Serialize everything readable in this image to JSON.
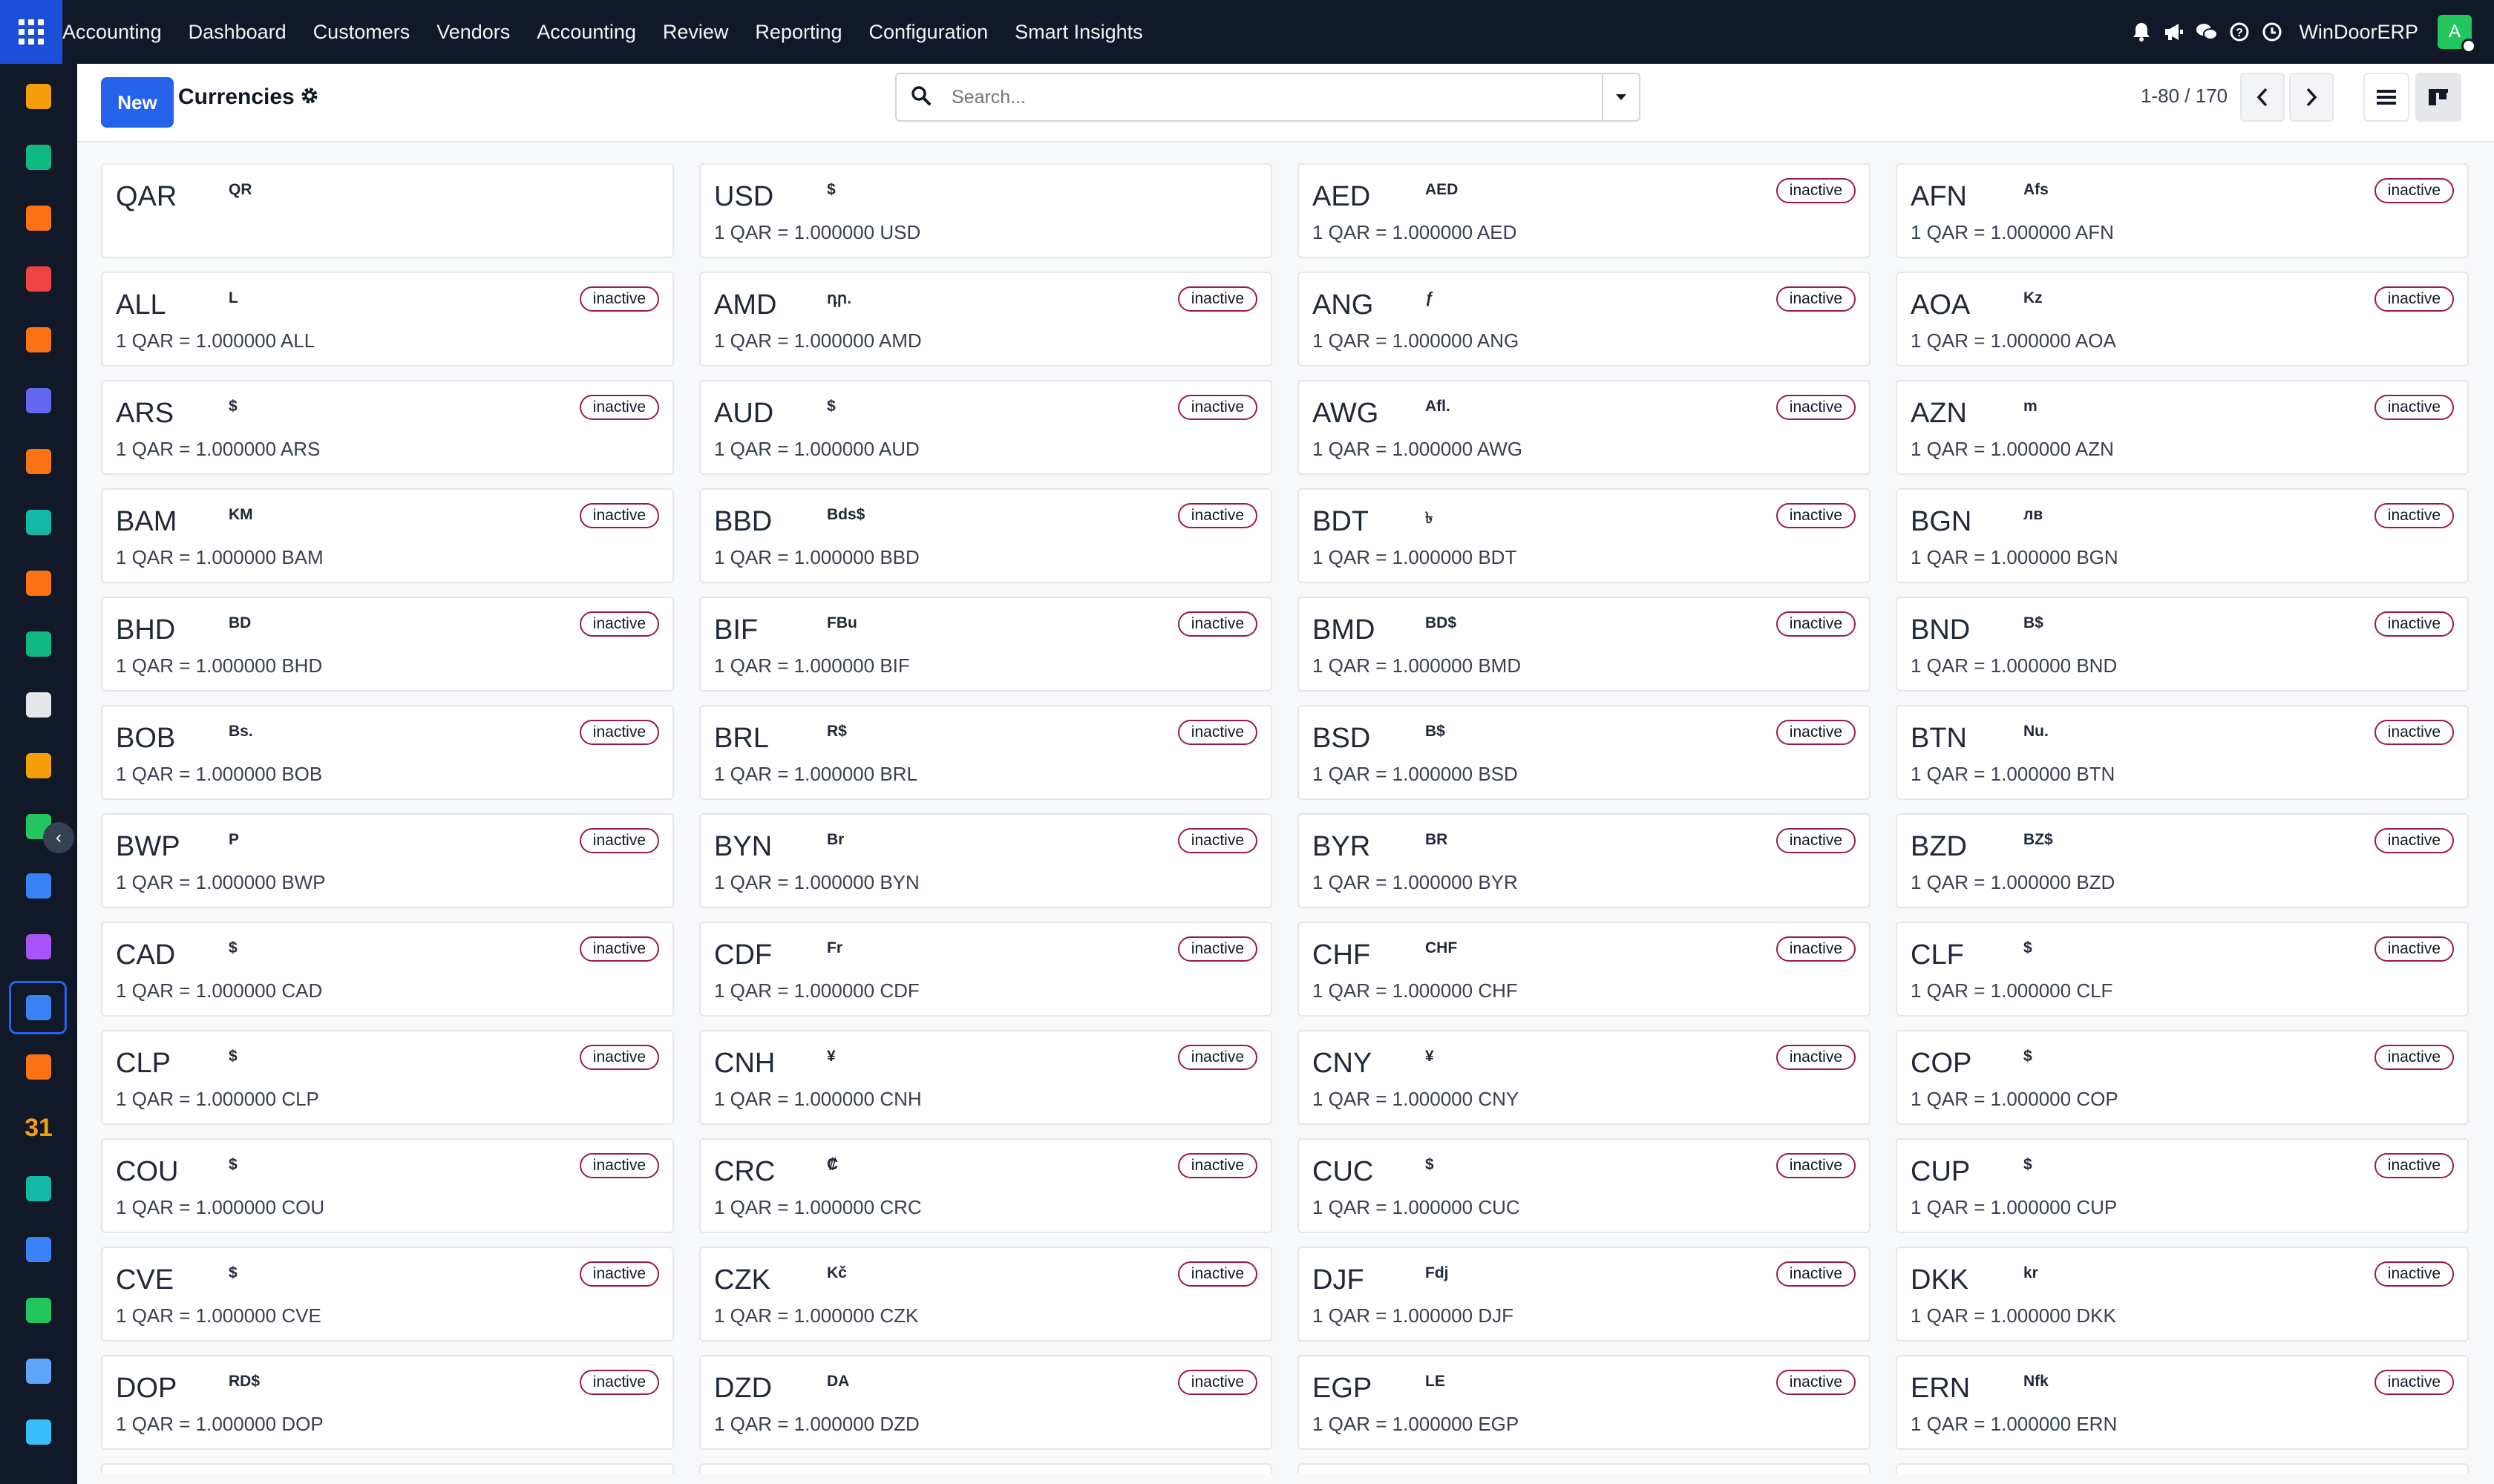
{
  "navbar": {
    "brand": "Accounting",
    "menu": [
      "Dashboard",
      "Customers",
      "Vendors",
      "Accounting",
      "Review",
      "Reporting",
      "Configuration",
      "Smart Insights"
    ],
    "company": "WinDoorERP",
    "avatar_letter": "A",
    "icons": [
      "bell-icon",
      "megaphone-icon",
      "chat-icon",
      "help-icon",
      "clock-icon"
    ]
  },
  "rail": {
    "apps": [
      {
        "name": "dashboard-app",
        "color": "#f59e0b"
      },
      {
        "name": "contacts-app",
        "color": "#10b981"
      },
      {
        "name": "reporting-app",
        "color": "#f97316"
      },
      {
        "name": "pie-app",
        "color": "#ef4444"
      },
      {
        "name": "discuss-app",
        "color": "#f97316"
      },
      {
        "name": "mail-app",
        "color": "#6366f1"
      },
      {
        "name": "livechat-app",
        "color": "#f97316"
      },
      {
        "name": "field-app",
        "color": "#14b8a6"
      },
      {
        "name": "sales-app",
        "color": "#f97316"
      },
      {
        "name": "employees-app",
        "color": "#10b981"
      },
      {
        "name": "inventory-app",
        "color": "#e5e7eb"
      },
      {
        "name": "studio-app",
        "color": "#f59e0b"
      },
      {
        "name": "project-app",
        "color": "#22c55e"
      },
      {
        "name": "knowledge-app",
        "color": "#3b82f6"
      },
      {
        "name": "package-app",
        "color": "#a855f7"
      },
      {
        "name": "accounting-app",
        "color": "#3b82f6"
      },
      {
        "name": "team-app",
        "color": "#f97316"
      },
      {
        "name": "calendar-app",
        "color": "#f59e0b"
      },
      {
        "name": "sign-app",
        "color": "#14b8a6"
      },
      {
        "name": "website-app",
        "color": "#3b82f6"
      },
      {
        "name": "whatsapp-app",
        "color": "#22c55e"
      },
      {
        "name": "timer-app",
        "color": "#60a5fa"
      },
      {
        "name": "odoo-app",
        "color": "#38bdf8"
      }
    ],
    "calendar_label": "31"
  },
  "control": {
    "new_label": "New",
    "title": "Currencies",
    "search_placeholder": "Search...",
    "pager": "1-80 / 170"
  },
  "cards": [
    {
      "code": "QAR",
      "symbol": "QR",
      "badge": "",
      "rate": ""
    },
    {
      "code": "USD",
      "symbol": "$",
      "badge": "",
      "rate": "1 QAR = 1.000000 USD"
    },
    {
      "code": "AED",
      "symbol": "AED",
      "badge": "inactive",
      "rate": "1 QAR = 1.000000 AED"
    },
    {
      "code": "AFN",
      "symbol": "Afs",
      "badge": "inactive",
      "rate": "1 QAR = 1.000000 AFN"
    },
    {
      "code": "ALL",
      "symbol": "L",
      "badge": "inactive",
      "rate": "1 QAR = 1.000000 ALL"
    },
    {
      "code": "AMD",
      "symbol": "դր.",
      "badge": "inactive",
      "rate": "1 QAR = 1.000000 AMD"
    },
    {
      "code": "ANG",
      "symbol": "ƒ",
      "badge": "inactive",
      "rate": "1 QAR = 1.000000 ANG"
    },
    {
      "code": "AOA",
      "symbol": "Kz",
      "badge": "inactive",
      "rate": "1 QAR = 1.000000 AOA"
    },
    {
      "code": "ARS",
      "symbol": "$",
      "badge": "inactive",
      "rate": "1 QAR = 1.000000 ARS"
    },
    {
      "code": "AUD",
      "symbol": "$",
      "badge": "inactive",
      "rate": "1 QAR = 1.000000 AUD"
    },
    {
      "code": "AWG",
      "symbol": "Afl.",
      "badge": "inactive",
      "rate": "1 QAR = 1.000000 AWG"
    },
    {
      "code": "AZN",
      "symbol": "m",
      "badge": "inactive",
      "rate": "1 QAR = 1.000000 AZN"
    },
    {
      "code": "BAM",
      "symbol": "KM",
      "badge": "inactive",
      "rate": "1 QAR = 1.000000 BAM"
    },
    {
      "code": "BBD",
      "symbol": "Bds$",
      "badge": "inactive",
      "rate": "1 QAR = 1.000000 BBD"
    },
    {
      "code": "BDT",
      "symbol": "৳",
      "badge": "inactive",
      "rate": "1 QAR = 1.000000 BDT"
    },
    {
      "code": "BGN",
      "symbol": "лв",
      "badge": "inactive",
      "rate": "1 QAR = 1.000000 BGN"
    },
    {
      "code": "BHD",
      "symbol": "BD",
      "badge": "inactive",
      "rate": "1 QAR = 1.000000 BHD"
    },
    {
      "code": "BIF",
      "symbol": "FBu",
      "badge": "inactive",
      "rate": "1 QAR = 1.000000 BIF"
    },
    {
      "code": "BMD",
      "symbol": "BD$",
      "badge": "inactive",
      "rate": "1 QAR = 1.000000 BMD"
    },
    {
      "code": "BND",
      "symbol": "B$",
      "badge": "inactive",
      "rate": "1 QAR = 1.000000 BND"
    },
    {
      "code": "BOB",
      "symbol": "Bs.",
      "badge": "inactive",
      "rate": "1 QAR = 1.000000 BOB"
    },
    {
      "code": "BRL",
      "symbol": "R$",
      "badge": "inactive",
      "rate": "1 QAR = 1.000000 BRL"
    },
    {
      "code": "BSD",
      "symbol": "B$",
      "badge": "inactive",
      "rate": "1 QAR = 1.000000 BSD"
    },
    {
      "code": "BTN",
      "symbol": "Nu.",
      "badge": "inactive",
      "rate": "1 QAR = 1.000000 BTN"
    },
    {
      "code": "BWP",
      "symbol": "P",
      "badge": "inactive",
      "rate": "1 QAR = 1.000000 BWP"
    },
    {
      "code": "BYN",
      "symbol": "Br",
      "badge": "inactive",
      "rate": "1 QAR = 1.000000 BYN"
    },
    {
      "code": "BYR",
      "symbol": "BR",
      "badge": "inactive",
      "rate": "1 QAR = 1.000000 BYR"
    },
    {
      "code": "BZD",
      "symbol": "BZ$",
      "badge": "inactive",
      "rate": "1 QAR = 1.000000 BZD"
    },
    {
      "code": "CAD",
      "symbol": "$",
      "badge": "inactive",
      "rate": "1 QAR = 1.000000 CAD"
    },
    {
      "code": "CDF",
      "symbol": "Fr",
      "badge": "inactive",
      "rate": "1 QAR = 1.000000 CDF"
    },
    {
      "code": "CHF",
      "symbol": "CHF",
      "badge": "inactive",
      "rate": "1 QAR = 1.000000 CHF"
    },
    {
      "code": "CLF",
      "symbol": "$",
      "badge": "inactive",
      "rate": "1 QAR = 1.000000 CLF"
    },
    {
      "code": "CLP",
      "symbol": "$",
      "badge": "inactive",
      "rate": "1 QAR = 1.000000 CLP"
    },
    {
      "code": "CNH",
      "symbol": "¥",
      "badge": "inactive",
      "rate": "1 QAR = 1.000000 CNH"
    },
    {
      "code": "CNY",
      "symbol": "¥",
      "badge": "inactive",
      "rate": "1 QAR = 1.000000 CNY"
    },
    {
      "code": "COP",
      "symbol": "$",
      "badge": "inactive",
      "rate": "1 QAR = 1.000000 COP"
    },
    {
      "code": "COU",
      "symbol": "$",
      "badge": "inactive",
      "rate": "1 QAR = 1.000000 COU"
    },
    {
      "code": "CRC",
      "symbol": "₡",
      "badge": "inactive",
      "rate": "1 QAR = 1.000000 CRC"
    },
    {
      "code": "CUC",
      "symbol": "$",
      "badge": "inactive",
      "rate": "1 QAR = 1.000000 CUC"
    },
    {
      "code": "CUP",
      "symbol": "$",
      "badge": "inactive",
      "rate": "1 QAR = 1.000000 CUP"
    },
    {
      "code": "CVE",
      "symbol": "$",
      "badge": "inactive",
      "rate": "1 QAR = 1.000000 CVE"
    },
    {
      "code": "CZK",
      "symbol": "Kč",
      "badge": "inactive",
      "rate": "1 QAR = 1.000000 CZK"
    },
    {
      "code": "DJF",
      "symbol": "Fdj",
      "badge": "inactive",
      "rate": "1 QAR = 1.000000 DJF"
    },
    {
      "code": "DKK",
      "symbol": "kr",
      "badge": "inactive",
      "rate": "1 QAR = 1.000000 DKK"
    },
    {
      "code": "DOP",
      "symbol": "RD$",
      "badge": "inactive",
      "rate": "1 QAR = 1.000000 DOP"
    },
    {
      "code": "DZD",
      "symbol": "DA",
      "badge": "inactive",
      "rate": "1 QAR = 1.000000 DZD"
    },
    {
      "code": "EGP",
      "symbol": "LE",
      "badge": "inactive",
      "rate": "1 QAR = 1.000000 EGP"
    },
    {
      "code": "ERN",
      "symbol": "Nfk",
      "badge": "inactive",
      "rate": "1 QAR = 1.000000 ERN"
    }
  ]
}
